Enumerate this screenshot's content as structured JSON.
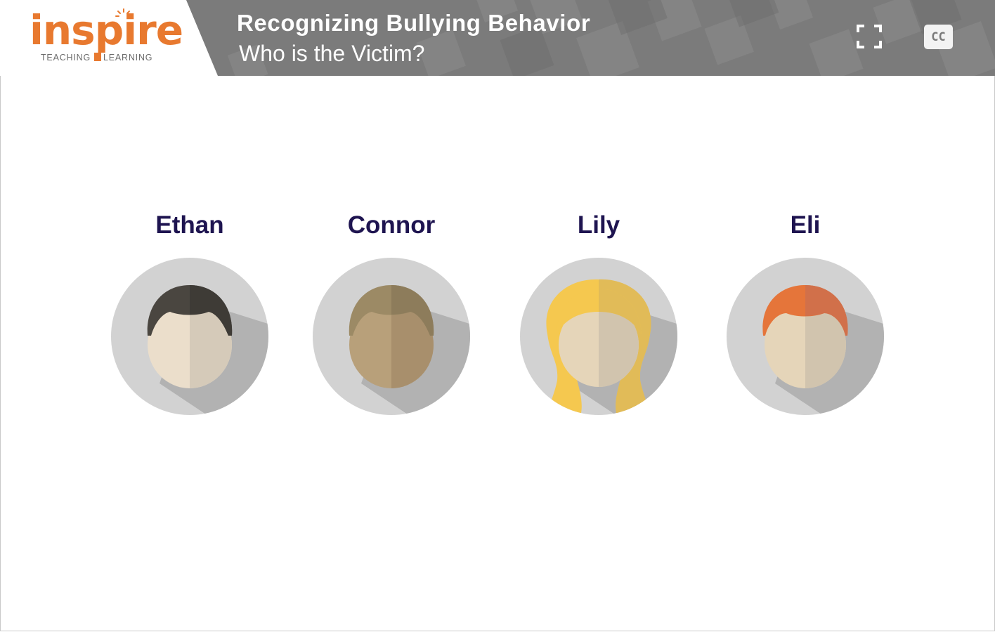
{
  "header": {
    "logo": {
      "word": "inspire",
      "tag_left": "TEACHING",
      "tag_right": "LEARNING"
    },
    "title": "Recognizing Bullying Behavior",
    "subtitle": "Who is the Victim?",
    "fullscreen_icon": "fullscreen-icon",
    "cc_label": "CC"
  },
  "colors": {
    "header_bg": "#7b7b7b",
    "brand_orange": "#e8792f",
    "name_text": "#1e1450",
    "avatar_bg": "#d2d2d2"
  },
  "people": [
    {
      "name": "Ethan",
      "hair": "dark-brown-short",
      "hair_color": "#4a4640",
      "skin": "#ebdecb"
    },
    {
      "name": "Connor",
      "hair": "light-brown-short",
      "hair_color": "#9c8a65",
      "skin": "#b8a07a"
    },
    {
      "name": "Lily",
      "hair": "blonde-long",
      "hair_color": "#f5c84f",
      "skin": "#e5d5b9"
    },
    {
      "name": "Eli",
      "hair": "red-short",
      "hair_color": "#e5753a",
      "skin": "#e5d5b9"
    }
  ]
}
